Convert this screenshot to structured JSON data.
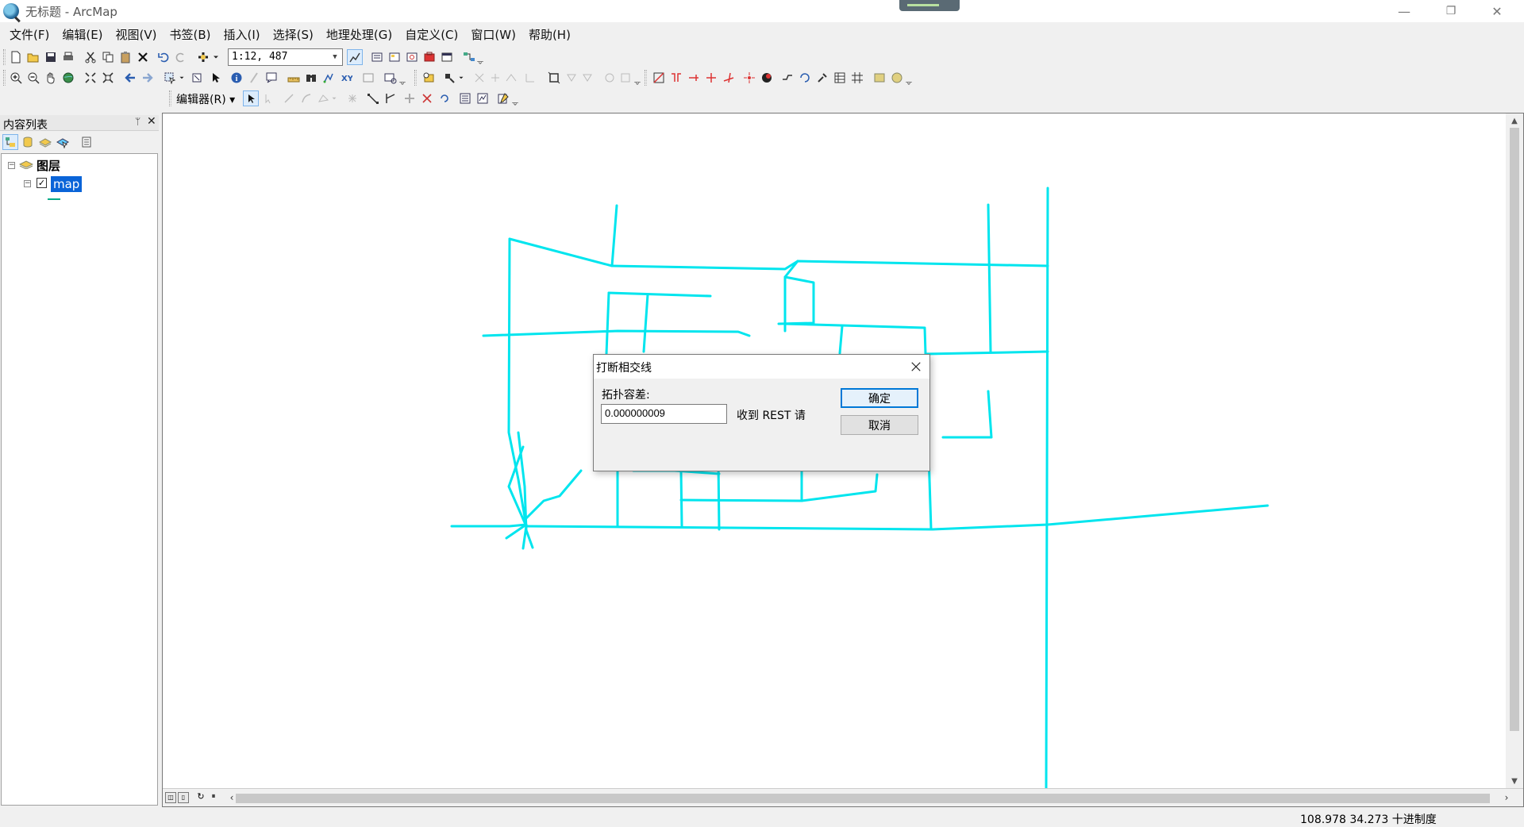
{
  "window": {
    "title": "无标题 - ArcMap",
    "minimize": "—",
    "restore": "❐",
    "close": "✕"
  },
  "menu": [
    {
      "label": "文件(F)"
    },
    {
      "label": "编辑(E)"
    },
    {
      "label": "视图(V)"
    },
    {
      "label": "书签(B)"
    },
    {
      "label": "插入(I)"
    },
    {
      "label": "选择(S)"
    },
    {
      "label": "地理处理(G)"
    },
    {
      "label": "自定义(C)"
    },
    {
      "label": "窗口(W)"
    },
    {
      "label": "帮助(H)"
    }
  ],
  "standard_toolbar": {
    "scale_value": "1:12, 487"
  },
  "editor_toolbar": {
    "label": "编辑器(R) ▾"
  },
  "toc": {
    "title": "内容列表",
    "pin_glyph": "ᛘ",
    "close_glyph": "✕",
    "layers_root": "图层",
    "layer_name": "map",
    "layer_checked": true
  },
  "map": {
    "line_color": "#00e5ee"
  },
  "statusbar": {
    "coordinates": "108.978  34.273 十进制度"
  },
  "dialog": {
    "title": "打断相交线",
    "tolerance_label": "拓扑容差:",
    "tolerance_value": "0.000000009",
    "hint_text": "收到 REST 请",
    "ok_label": "确定",
    "cancel_label": "取消"
  }
}
